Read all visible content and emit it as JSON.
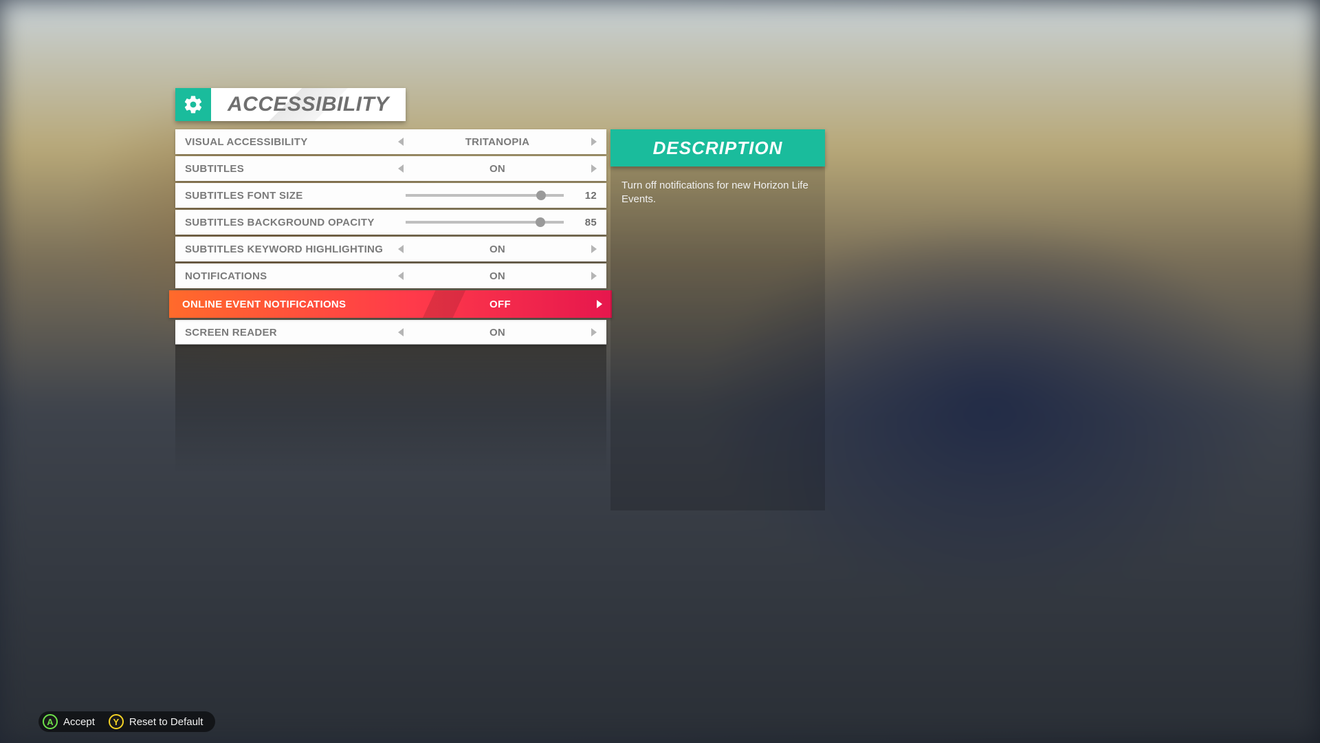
{
  "header": {
    "title": "ACCESSIBILITY"
  },
  "rows": [
    {
      "type": "choice",
      "label": "VISUAL ACCESSIBILITY",
      "value": "TRITANOPIA",
      "selected": false
    },
    {
      "type": "choice",
      "label": "SUBTITLES",
      "value": "ON",
      "selected": false
    },
    {
      "type": "slider",
      "label": "SUBTITLES FONT SIZE",
      "value": 12,
      "min": 0,
      "max": 14,
      "selected": false
    },
    {
      "type": "slider",
      "label": "SUBTITLES BACKGROUND OPACITY",
      "value": 85,
      "min": 0,
      "max": 100,
      "selected": false
    },
    {
      "type": "choice",
      "label": "SUBTITLES KEYWORD HIGHLIGHTING",
      "value": "ON",
      "selected": false
    },
    {
      "type": "choice",
      "label": "NOTIFICATIONS",
      "value": "ON",
      "selected": false
    },
    {
      "type": "choice",
      "label": "ONLINE EVENT NOTIFICATIONS",
      "value": "OFF",
      "selected": true
    },
    {
      "type": "choice",
      "label": "SCREEN READER",
      "value": "ON",
      "selected": false
    }
  ],
  "description": {
    "title": "DESCRIPTION",
    "body": "Turn off notifications for new Horizon Life Events."
  },
  "footer": {
    "accept": {
      "button": "A",
      "label": "Accept"
    },
    "reset": {
      "button": "Y",
      "label": "Reset to Default"
    }
  },
  "colors": {
    "teal": "#1abc9c",
    "selected_gradient_start": "#ff6a2b",
    "selected_gradient_end": "#e6174d"
  }
}
